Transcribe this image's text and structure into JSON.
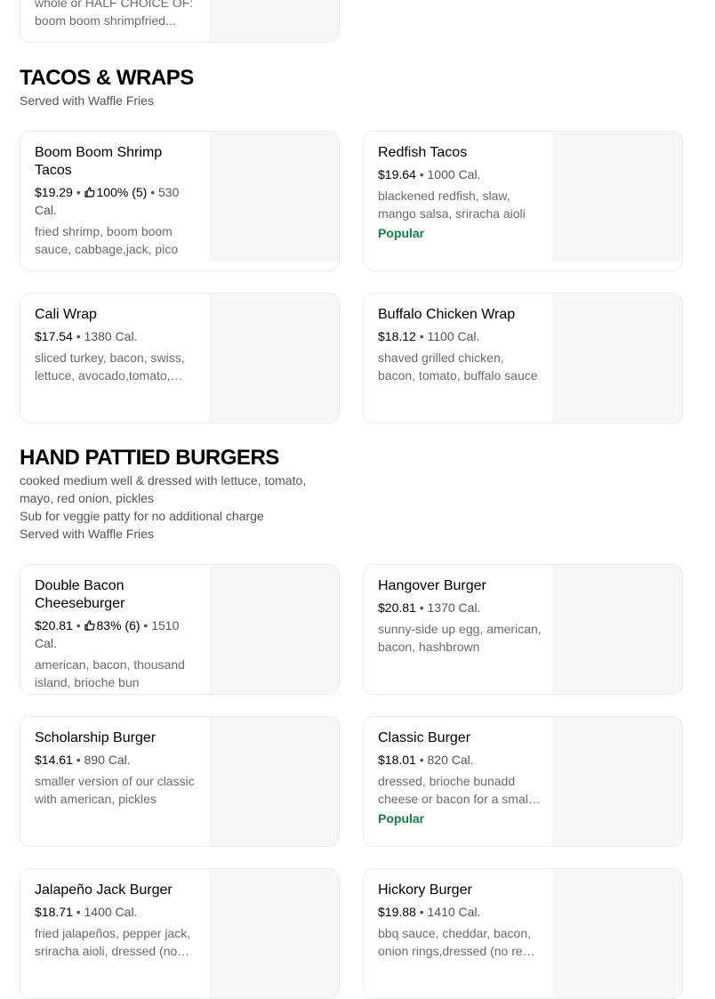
{
  "previous_card": {
    "desc_line1": "whole or HALF CHOICE OF:",
    "desc_line2": "boom boom shrimpfried..."
  },
  "sections": [
    {
      "title": "TACOS & WRAPS",
      "subtitle_lines": [
        "Served with Waffle Fries"
      ]
    },
    {
      "title": "HAND PATTIED BURGERS",
      "subtitle_lines": [
        "cooked medium well & dressed with lettuce, tomato,",
        "mayo, red onion, pickles",
        "Sub for veggie patty for no additional charge",
        "Served with Waffle Fries"
      ]
    }
  ],
  "items": [
    {
      "name": "Boom Boom Shrimp Tacos",
      "price": "$19.29",
      "rating": "100% (5)",
      "cal": "530 Cal.",
      "desc": "fried shrimp, boom boom sauce, cabbage,jack, pico",
      "popular": ""
    },
    {
      "name": "Redfish Tacos",
      "price": "$19.64",
      "rating": "",
      "cal": "1000 Cal.",
      "desc": "blackened redfish, slaw, mango salsa, sriracha aioli",
      "popular": "Popular"
    },
    {
      "name": "Cali Wrap",
      "price": "$17.54",
      "rating": "",
      "cal": "1380 Cal.",
      "desc": "sliced turkey, bacon, swiss, lettuce, avocado,tomato, ranch",
      "popular": ""
    },
    {
      "name": "Buffalo Chicken Wrap",
      "price": "$18.12",
      "rating": "",
      "cal": "1100 Cal.",
      "desc": "shaved grilled chicken, bacon, tomato, buffalo sauce",
      "popular": ""
    },
    {
      "name": "Double Bacon Cheeseburger",
      "price": "$20.81",
      "rating": "83% (6)",
      "cal": "1510 Cal.",
      "desc": "american, bacon, thousand island, brioche bun",
      "popular": ""
    },
    {
      "name": "Hangover Burger",
      "price": "$20.81",
      "rating": "",
      "cal": "1370 Cal.",
      "desc": "sunny-side up egg, american, bacon, hashbrown",
      "popular": ""
    },
    {
      "name": "Scholarship Burger",
      "price": "$14.61",
      "rating": "",
      "cal": "890 Cal.",
      "desc": "smaller version of our classic with american, pickles",
      "popular": ""
    },
    {
      "name": "Classic Burger",
      "price": "$18.01",
      "rating": "",
      "cal": "820 Cal.",
      "desc": "dressed, brioche bunadd cheese or bacon for a small charge",
      "popular": "Popular"
    },
    {
      "name": "Jalapeño Jack Burger",
      "price": "$18.71",
      "rating": "",
      "cal": "1400 Cal.",
      "desc": "fried jalapeños, pepper jack, sriracha aioli, dressed (no pickles)",
      "popular": ""
    },
    {
      "name": "Hickory Burger",
      "price": "$19.88",
      "rating": "",
      "cal": "1410 Cal.",
      "desc": "bbq sauce, cheddar, bacon, onion rings,dressed (no red onion)",
      "popular": ""
    }
  ],
  "colors": {
    "popular": "#0e8345",
    "image_placeholder": "#f6f6f6"
  },
  "icons": {
    "rating": "thumbs-up-icon"
  }
}
